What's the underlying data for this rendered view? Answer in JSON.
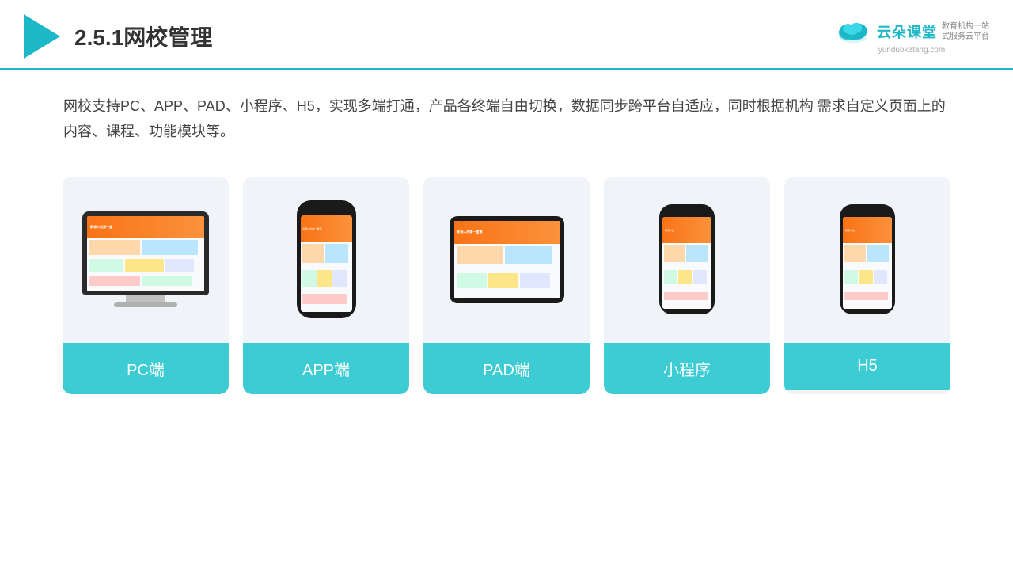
{
  "header": {
    "title": "2.5.1网校管理",
    "brand": {
      "name": "云朵课堂",
      "subtitle": "教育机构一站\n式服务云平台",
      "url": "yunduoketang.com"
    }
  },
  "description": "网校支持PC、APP、PAD、小程序、H5，实现多端打通，产品各终端自由切换，数据同步跨平台自适应，同时根据机构\n需求自定义页面上的内容、课程、功能模块等。",
  "cards": [
    {
      "id": "pc",
      "label": "PC端",
      "type": "pc"
    },
    {
      "id": "app",
      "label": "APP端",
      "type": "phone"
    },
    {
      "id": "pad",
      "label": "PAD端",
      "type": "pad"
    },
    {
      "id": "miniprogram",
      "label": "小程序",
      "type": "phone2"
    },
    {
      "id": "h5",
      "label": "H5",
      "type": "phone3"
    }
  ],
  "colors": {
    "accent": "#3dcbd4",
    "header_line": "#1db8c8"
  }
}
